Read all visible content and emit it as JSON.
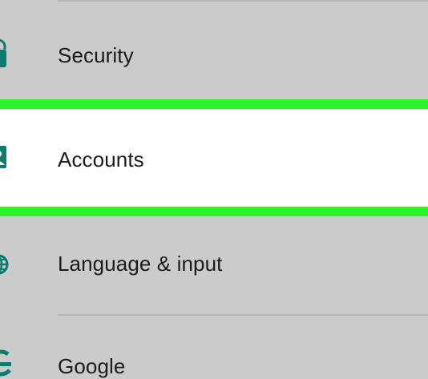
{
  "settings": {
    "items": [
      {
        "label": "Security",
        "icon": "lock-icon"
      },
      {
        "label": "Accounts",
        "icon": "account-icon"
      },
      {
        "label": "Language & input",
        "icon": "globe-icon"
      },
      {
        "label": "Google",
        "icon": "google-icon"
      }
    ]
  },
  "colors": {
    "background": "#cbcbcb",
    "highlight": "#2cf22c",
    "selected_background": "#ffffff",
    "icon": "#0e7a6e",
    "text": "#1c1c1c"
  }
}
